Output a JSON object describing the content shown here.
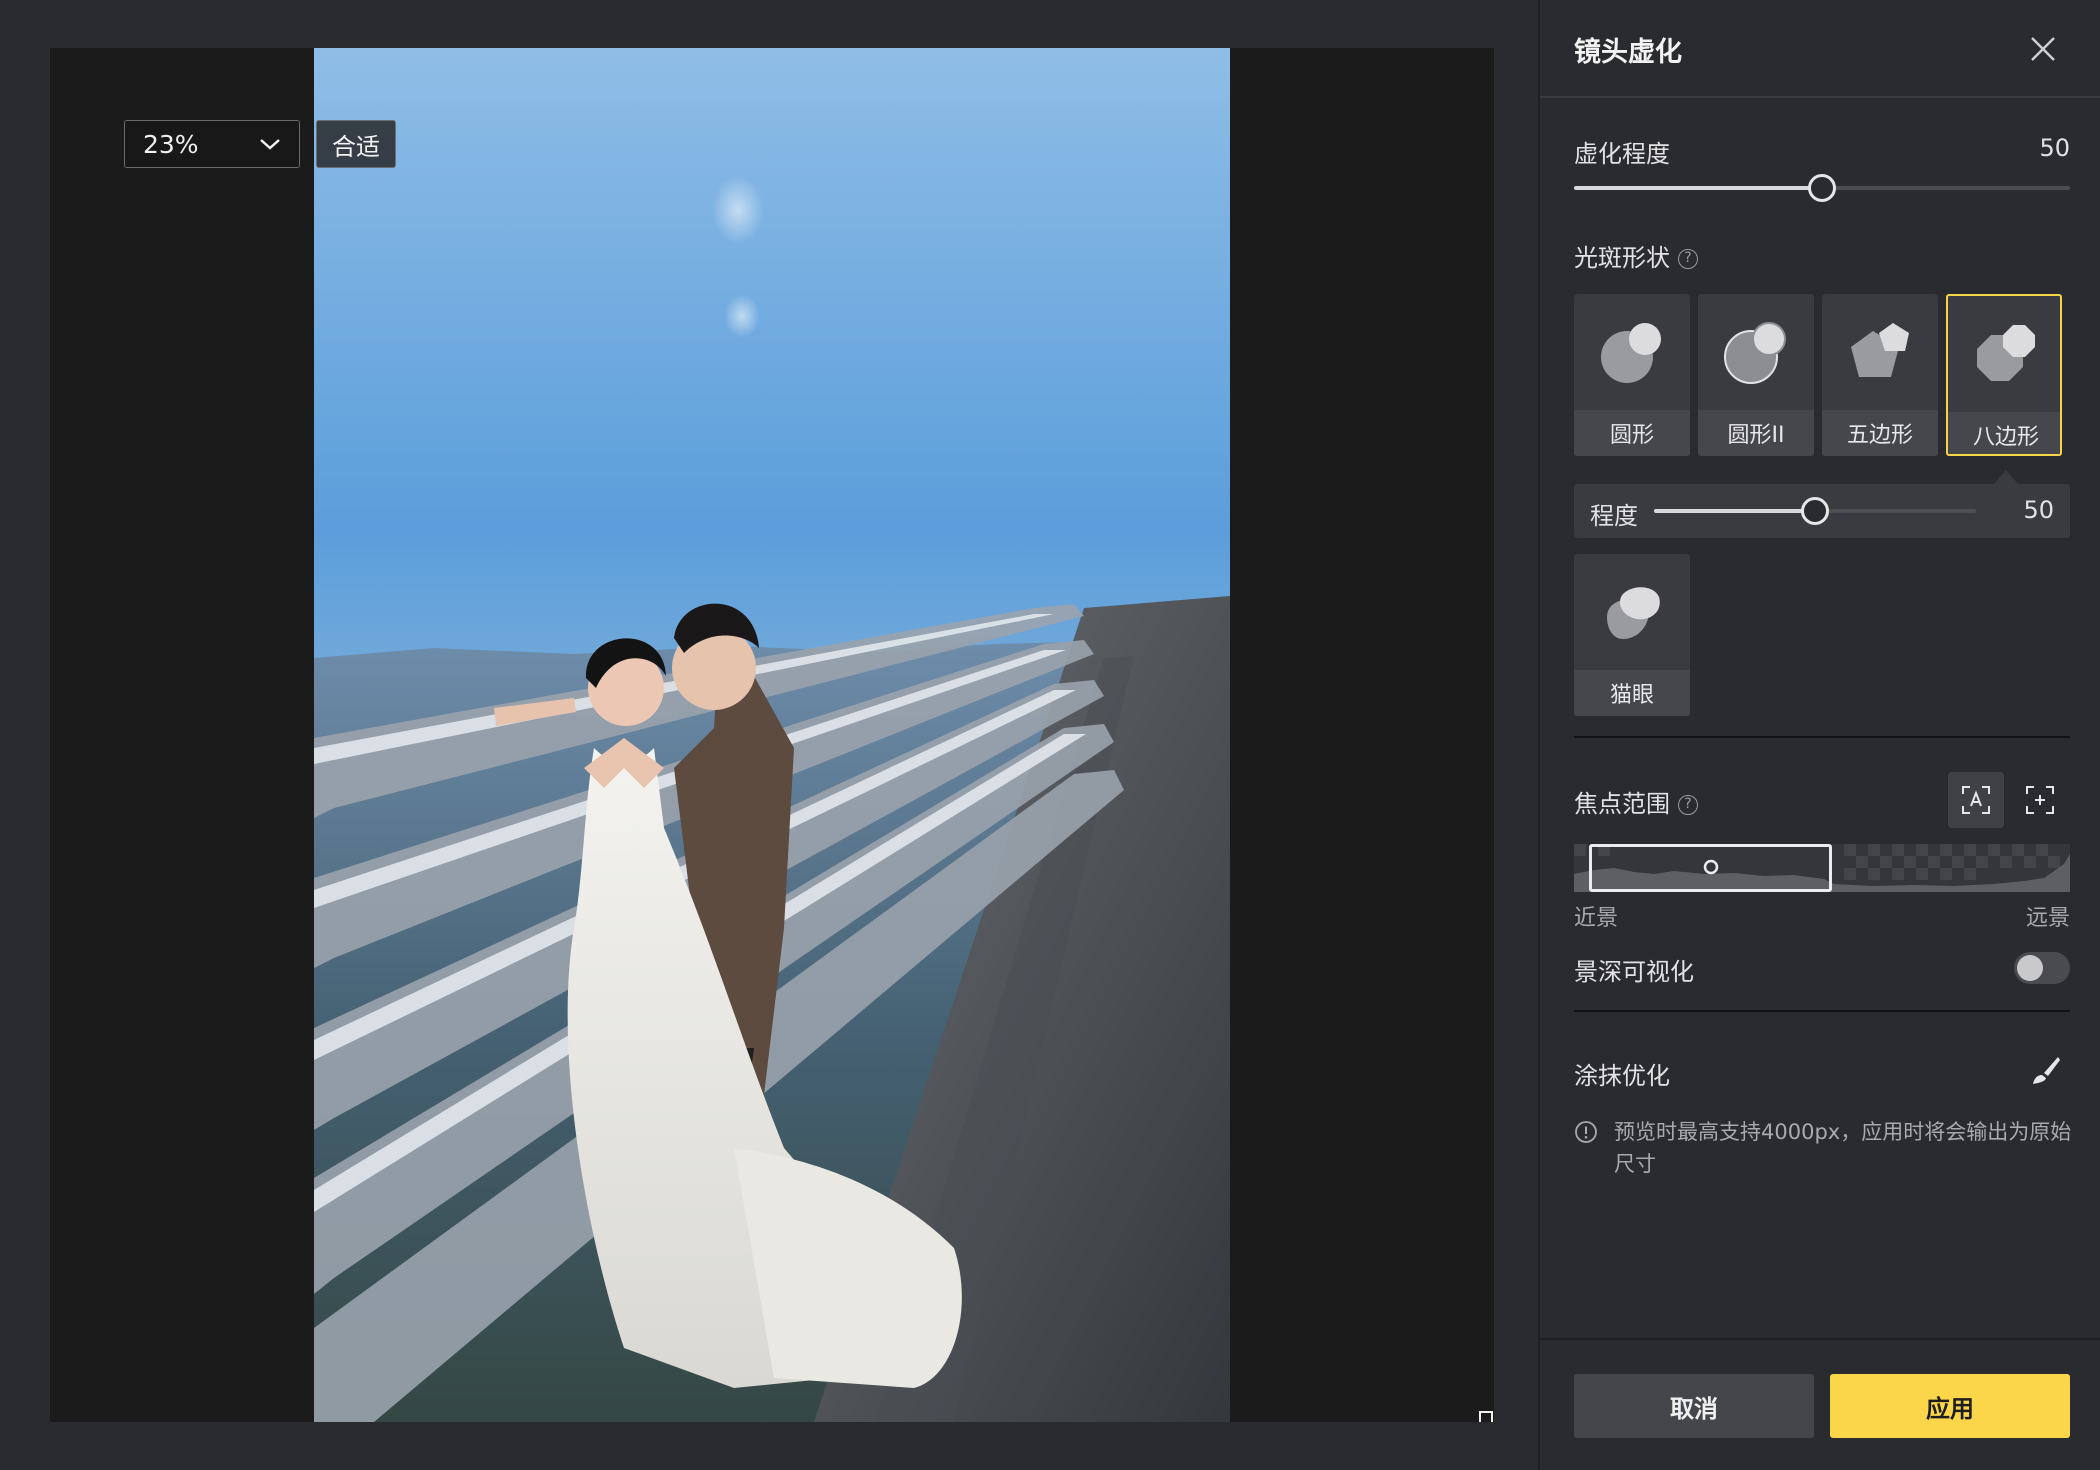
{
  "canvas": {
    "zoom": "23%",
    "fit_label": "合适"
  },
  "panel": {
    "title": "镜头虚化",
    "blur_amount": {
      "label": "虚化程度",
      "value": "50",
      "level": 0.5
    },
    "bokeh_shape": {
      "label": "光斑形状",
      "shapes": [
        {
          "label": "圆形",
          "icon": "circle-bokeh-icon"
        },
        {
          "label": "圆形II",
          "icon": "circle-ii-bokeh-icon"
        },
        {
          "label": "五边形",
          "icon": "pentagon-bokeh-icon"
        },
        {
          "label": "八边形",
          "icon": "octagon-bokeh-icon"
        },
        {
          "label": "猫眼",
          "icon": "cats-eye-bokeh-icon"
        }
      ],
      "selected": "八边形",
      "strength": {
        "label": "程度",
        "value": "50",
        "level": 0.5
      }
    },
    "focus_range": {
      "label": "焦点范围",
      "near_label": "近景",
      "far_label": "远景",
      "window_start": 0.03,
      "window_end": 0.52
    },
    "depth_visualization": {
      "label": "景深可视化",
      "enabled": false
    },
    "brush_optimize": {
      "label": "涂抹优化"
    },
    "notice": "预览时最高支持4000px，应用时将会输出为原始尺寸",
    "cancel_label": "取消",
    "apply_label": "应用"
  },
  "colors": {
    "accent": "#fbd64a",
    "selected_border": "#f5d547",
    "panel_bg": "#2a2b2f",
    "card_bg": "#3a3b40"
  }
}
